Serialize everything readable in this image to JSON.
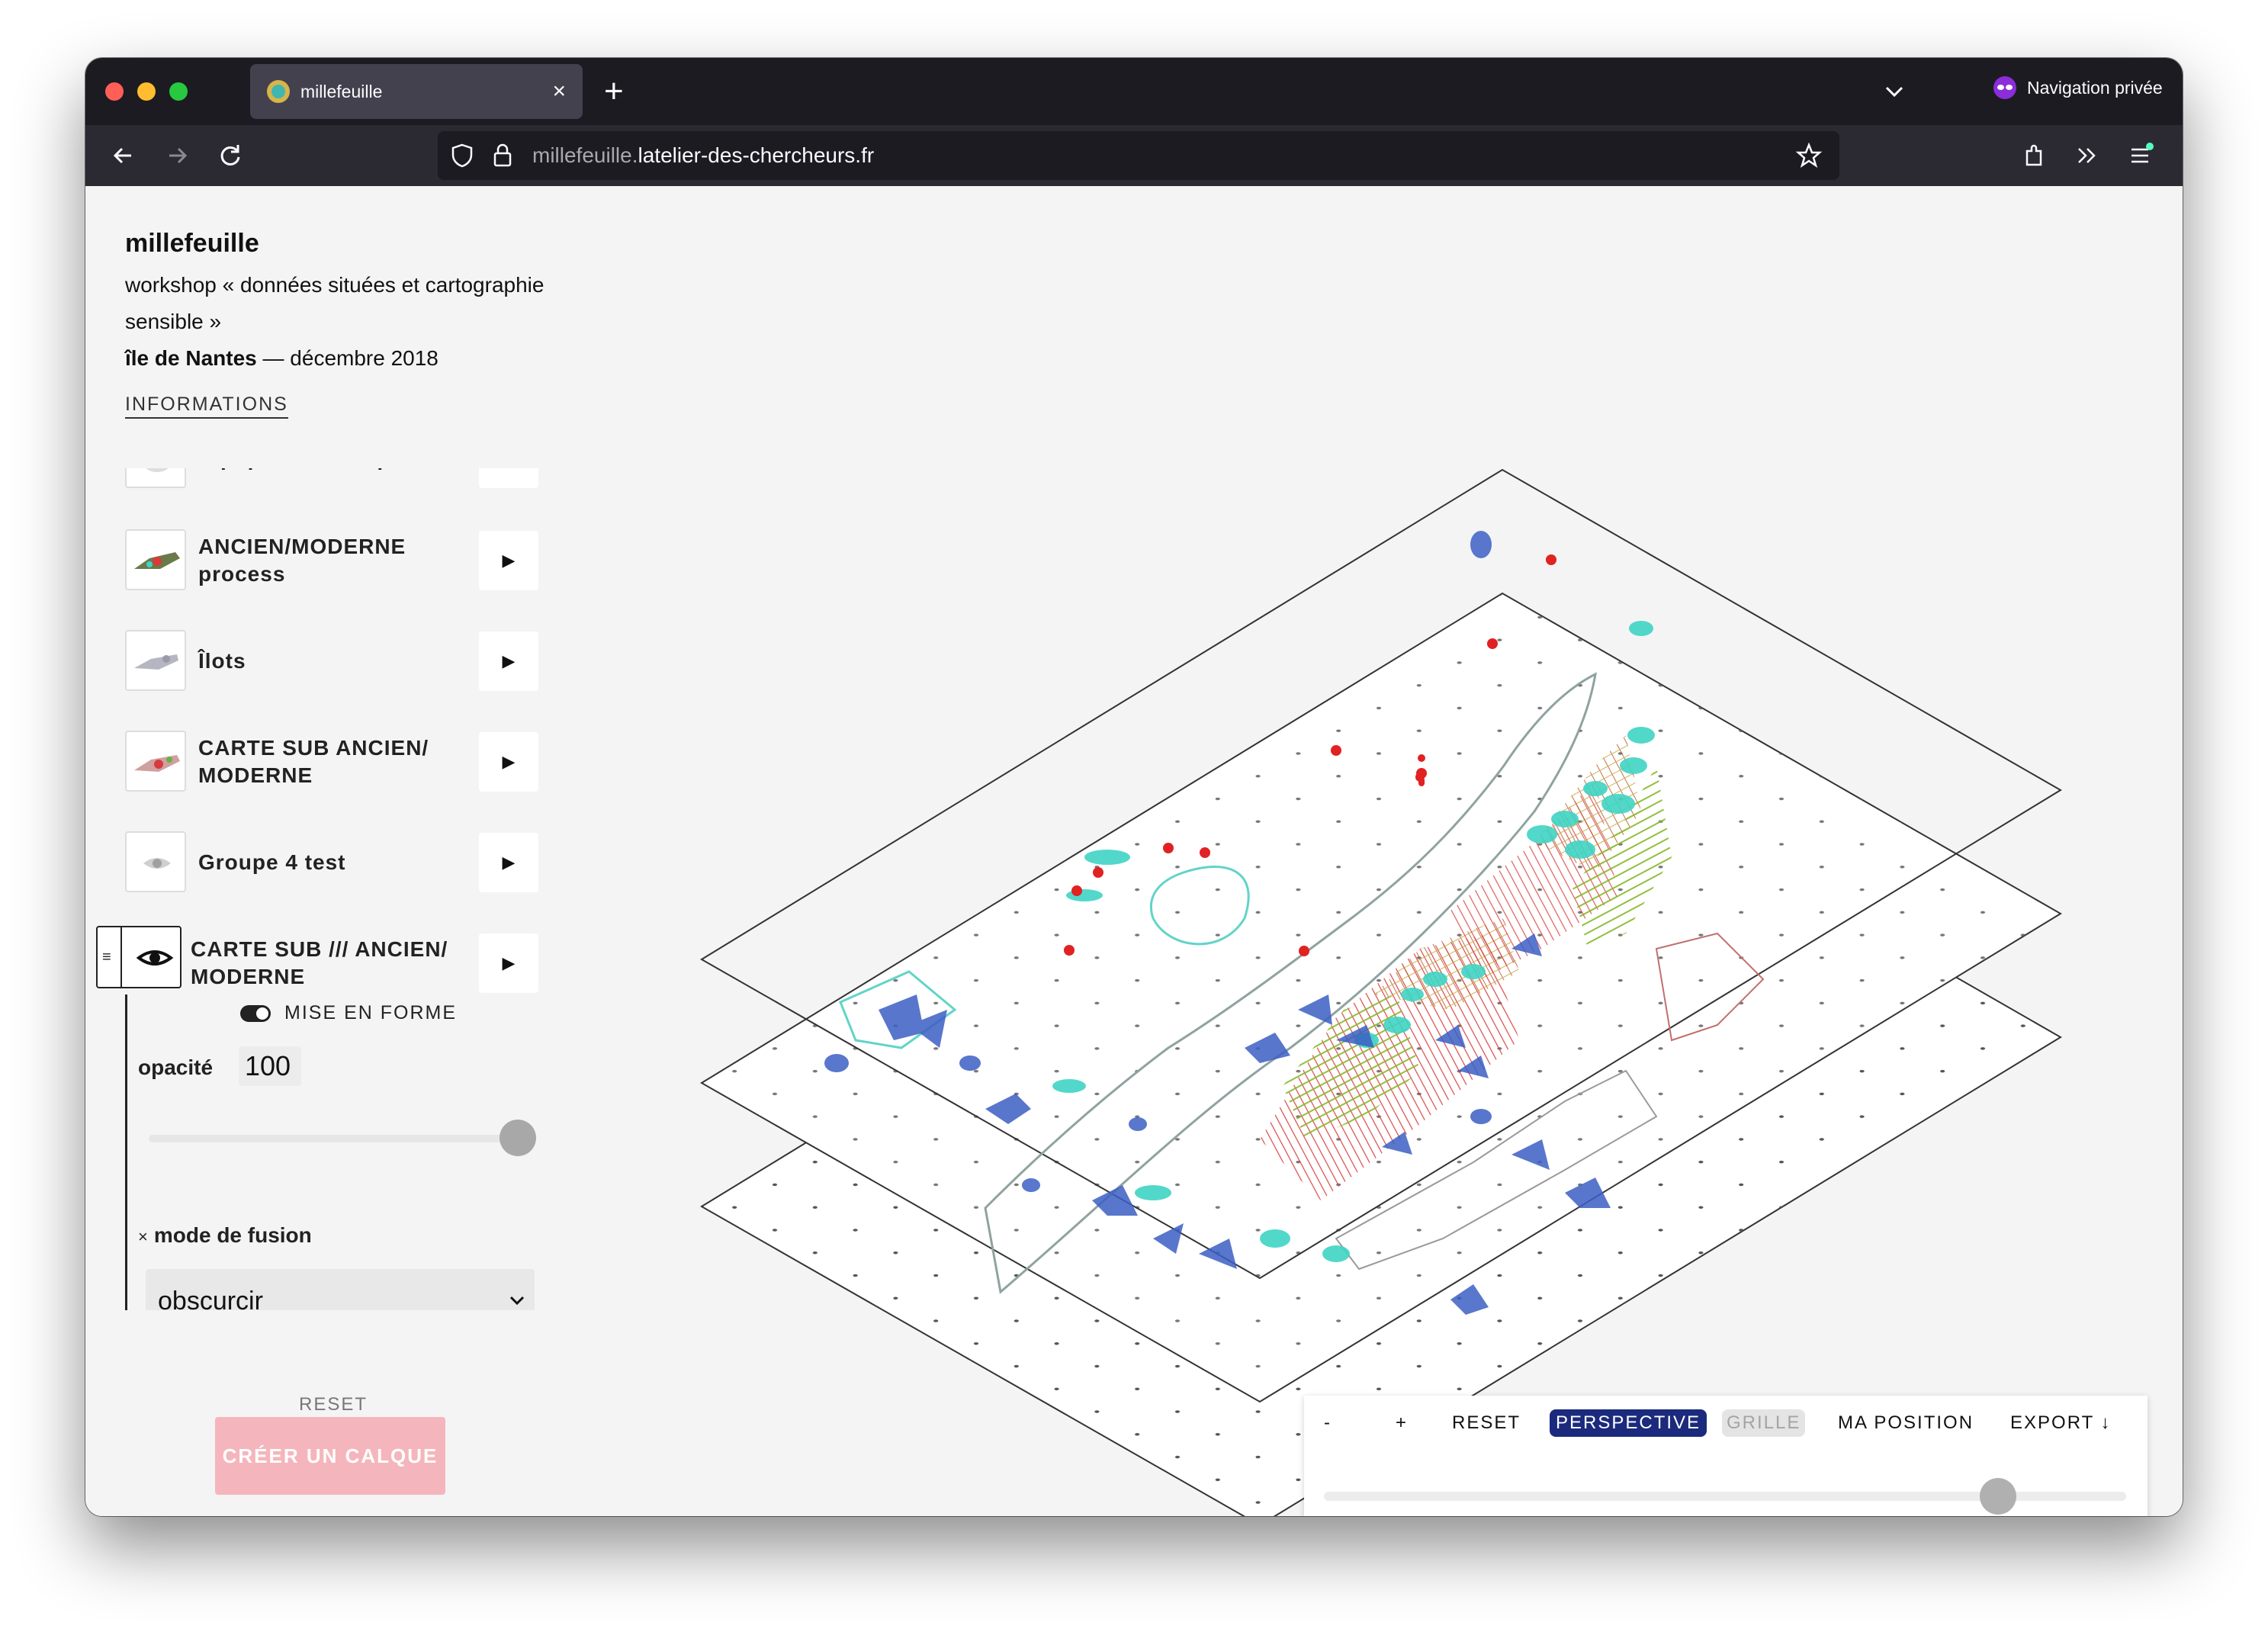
{
  "browser": {
    "tab_title": "millefeuille",
    "tab_close": "×",
    "new_tab": "+",
    "private_label": "Navigation privée",
    "url_prefix": "millefeuille.",
    "url_domain": "latelier-des-chercheurs.fr",
    "icons": [
      "back-icon",
      "forward-icon",
      "reload-icon",
      "shield-icon",
      "lock-icon",
      "star-icon",
      "extensions-icon",
      "overflow-icon",
      "menu-icon"
    ]
  },
  "site": {
    "title": "millefeuille",
    "description": "workshop « données situées et cartographie sensible »",
    "place": "île de Nantes",
    "date": " — décembre 2018",
    "info_link": "INFORMATIONS"
  },
  "layers": [
    {
      "name": "Equipements - Sport"
    },
    {
      "name": "ANCIEN/MODERNE process"
    },
    {
      "name": "Îlots"
    },
    {
      "name": "CARTE SUB ANCIEN/ MODERNE"
    },
    {
      "name": "Groupe 4 test"
    },
    {
      "name": "CARTE SUB /// ANCIEN/ MODERNE"
    }
  ],
  "play_symbol": "▶",
  "layer_settings": {
    "drag_symbol": "≡",
    "toggle_label": "MISE EN FORME",
    "opacity_label": "opacité",
    "opacity_value": "100",
    "opacity_level": 1.0,
    "fusion_clear": "×",
    "fusion_label": "mode de fusion",
    "fusion_value": "obscurcir"
  },
  "sidebar_actions": {
    "reset": "RESET",
    "create": "CRÉER UN CALQUE"
  },
  "map_toolbar": {
    "zoom_out": "-",
    "zoom_in": "+",
    "reset": "RESET",
    "perspective": "PERSPECTIVE",
    "grid": "GRILLE",
    "position": "MA POSITION",
    "export": "EXPORT ↓",
    "slider_level": 0.84
  },
  "colors": {
    "accent": "#1b2a7d",
    "create_button": "#f4b6bc",
    "map_red": "#d93a3a",
    "map_blue": "#3b5fc4",
    "map_teal": "#3fd4c4",
    "map_green": "#9ccf3a"
  }
}
